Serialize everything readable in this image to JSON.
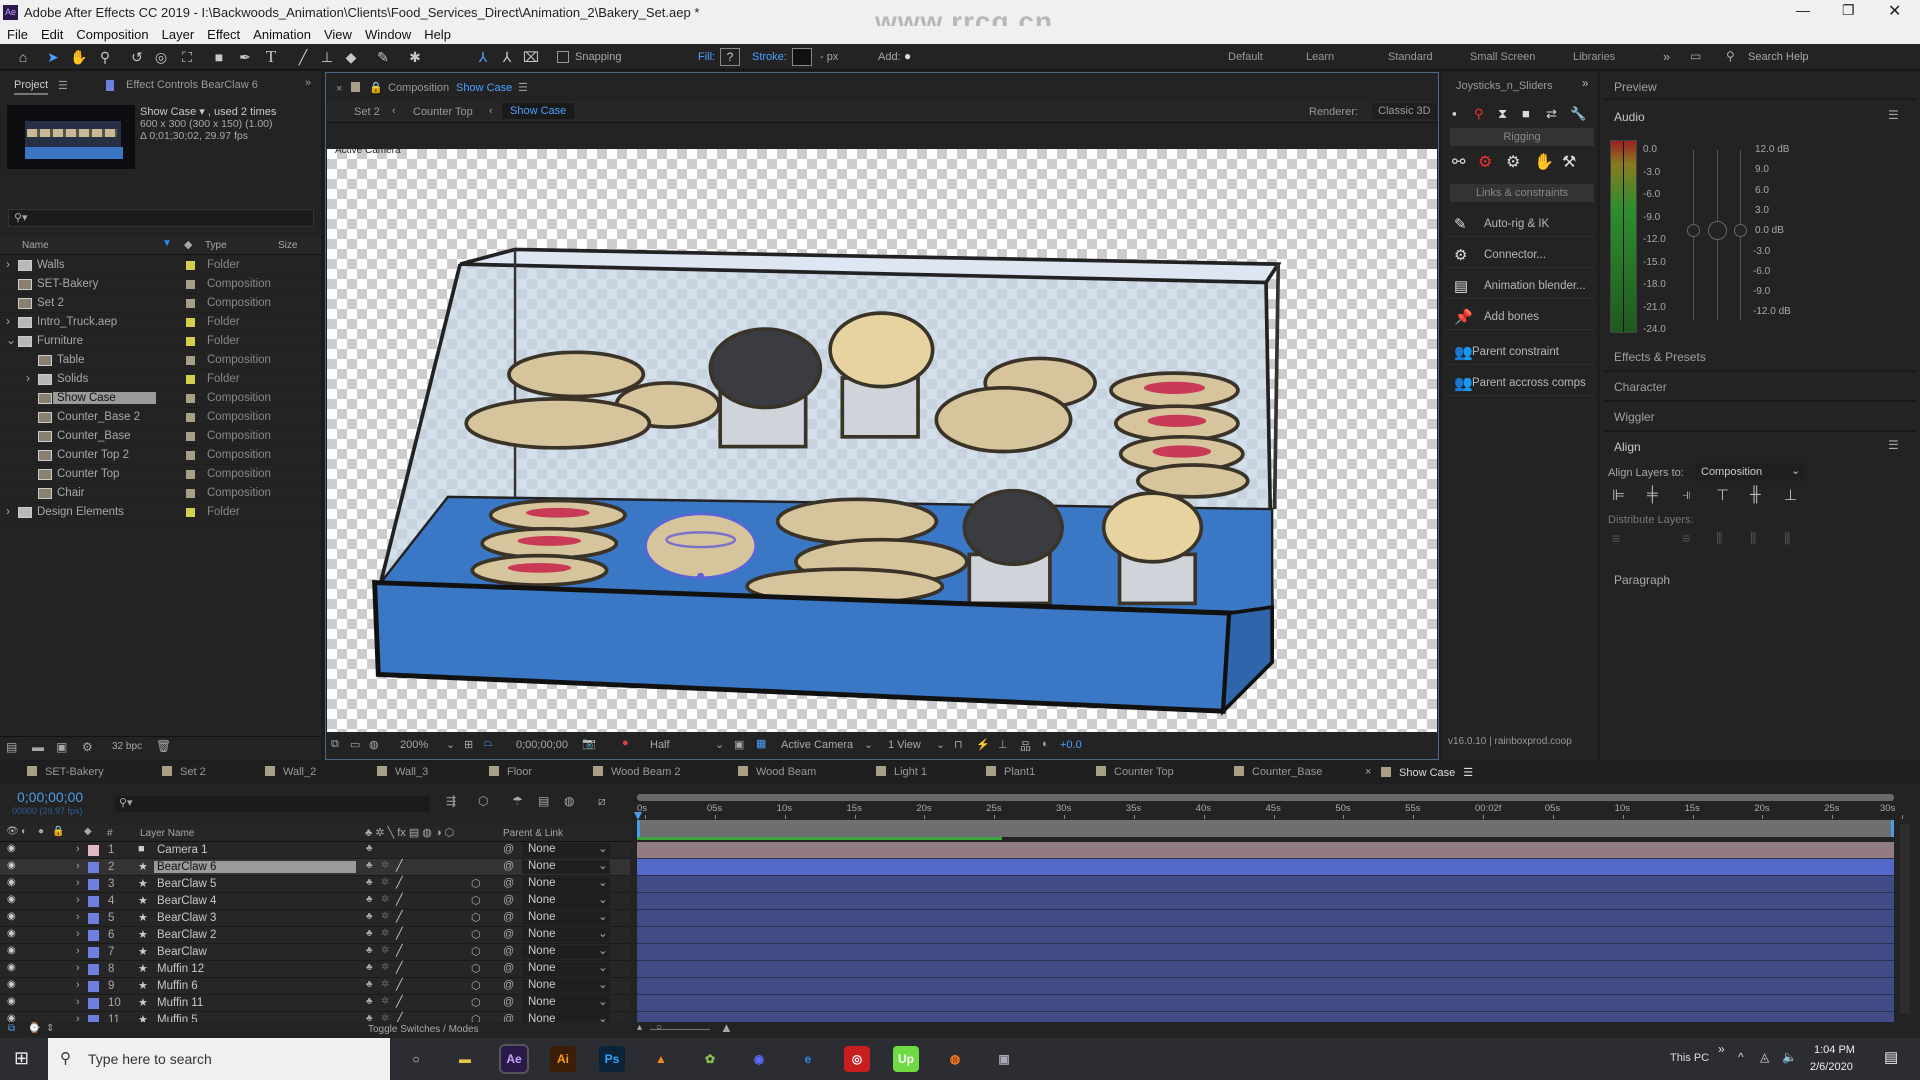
{
  "title_bar": {
    "app_icon": "Ae",
    "title": "Adobe After Effects CC 2019 - I:\\Backwoods_Animation\\Clients\\Food_Services_Direct\\Animation_2\\Bakery_Set.aep *",
    "watermark": "www.rrcg.cn",
    "controls": [
      "minimize-icon",
      "restore-icon",
      "close-icon"
    ]
  },
  "menu": [
    "File",
    "Edit",
    "Composition",
    "Layer",
    "Effect",
    "Animation",
    "View",
    "Window",
    "Help"
  ],
  "toolbar": {
    "snapping_label": "Snapping",
    "fill_label": "Fill:",
    "fill_value": "?",
    "stroke_label": "Stroke:",
    "stroke_units": "- px",
    "add_label": "Add:",
    "workspaces": [
      "Default",
      "Learn",
      "Standard",
      "Small Screen",
      "Libraries"
    ],
    "search_help": "Search Help"
  },
  "project_panel": {
    "tab_project": "Project",
    "tab_effect_controls": "Effect Controls BearClaw 6",
    "info_name": "Show Case ▾ , used 2 times",
    "info_size": "600 x 300  (300 x 150) (1.00)",
    "info_duration": "Δ 0;01;30;02, 29.97 fps",
    "search_placeholder": "",
    "columns": {
      "name": "Name",
      "type": "Type",
      "size": "Size"
    },
    "items": [
      {
        "name": "Walls",
        "type": "Folder",
        "kind": "folder",
        "depth": 0,
        "expander": "›"
      },
      {
        "name": "SET-Bakery",
        "type": "Composition",
        "kind": "comp",
        "depth": 0,
        "expander": ""
      },
      {
        "name": "Set 2",
        "type": "Composition",
        "kind": "comp",
        "depth": 0,
        "expander": ""
      },
      {
        "name": "Intro_Truck.aep",
        "type": "Folder",
        "kind": "folder",
        "depth": 0,
        "expander": "›"
      },
      {
        "name": "Furniture",
        "type": "Folder",
        "kind": "folder",
        "depth": 0,
        "expander": "⌄"
      },
      {
        "name": "Table",
        "type": "Composition",
        "kind": "comp",
        "depth": 1,
        "expander": ""
      },
      {
        "name": "Solids",
        "type": "Folder",
        "kind": "folder",
        "depth": 1,
        "expander": "›"
      },
      {
        "name": "Show Case",
        "type": "Composition",
        "kind": "comp",
        "depth": 1,
        "expander": "",
        "selected": true
      },
      {
        "name": "Counter_Base 2",
        "type": "Composition",
        "kind": "comp",
        "depth": 1,
        "expander": ""
      },
      {
        "name": "Counter_Base",
        "type": "Composition",
        "kind": "comp",
        "depth": 1,
        "expander": ""
      },
      {
        "name": "Counter Top 2",
        "type": "Composition",
        "kind": "comp",
        "depth": 1,
        "expander": ""
      },
      {
        "name": "Counter Top",
        "type": "Composition",
        "kind": "comp",
        "depth": 1,
        "expander": ""
      },
      {
        "name": "Chair",
        "type": "Composition",
        "kind": "comp",
        "depth": 1,
        "expander": ""
      },
      {
        "name": "Design Elements",
        "type": "Folder",
        "kind": "folder",
        "depth": 0,
        "expander": "›"
      }
    ],
    "bpc": "32 bpc"
  },
  "colors": {
    "folder_label": "#d4cf4c",
    "comp_label": "#a89f86",
    "accent": "#2d8ceb",
    "layer_blue": "#6f7fe0",
    "camera_pink": "#e0b8c2",
    "cache_green": "#3fa63f"
  },
  "composition_panel": {
    "tab_prefix": "Composition",
    "tab_name": "Show Case",
    "breadcrumbs": [
      "Set 2",
      "Counter Top",
      "Show Case"
    ],
    "renderer_label": "Renderer:",
    "renderer_value": "Classic 3D",
    "view_label": "Active Camera",
    "viewer_toolbar": {
      "zoom": "200%",
      "timecode": "0;00;00;00",
      "resolution": "Half",
      "camera": "Active Camera",
      "views": "1 View",
      "exposure": "+0.0"
    }
  },
  "joysticks_panel": {
    "title": "Joysticks_n_Sliders",
    "section_rigging": "Rigging",
    "section_links": "Links & constraints",
    "items": [
      "Auto-rig & IK",
      "Connector...",
      "Animation blender...",
      "Add bones",
      "Parent constraint",
      "Parent accross comps"
    ],
    "version": "v16.0.10 | rainboxprod.coop"
  },
  "right_panels": {
    "preview": "Preview",
    "audio": "Audio",
    "audio_left_scale": [
      "0.0",
      "-3.0",
      "-6.0",
      "-9.0",
      "-12.0",
      "-15.0",
      "-18.0",
      "-21.0",
      "-24.0"
    ],
    "audio_right_scale": [
      "12.0 dB",
      "9.0",
      "6.0",
      "3.0",
      "0.0 dB",
      "-3.0",
      "-6.0",
      "-9.0",
      "-12.0 dB"
    ],
    "effects_presets": "Effects & Presets",
    "character": "Character",
    "wiggler": "Wiggler",
    "align": "Align",
    "align_layers_to": "Align Layers to:",
    "align_target": "Composition",
    "distribute_layers": "Distribute Layers:",
    "paragraph": "Paragraph"
  },
  "timeline": {
    "tabs": [
      "SET-Bakery",
      "Set 2",
      "Wall_2",
      "Wall_3",
      "Floor",
      "Wood Beam 2",
      "Wood Beam",
      "Light 1",
      "Plant1",
      "Counter Top",
      "Counter_Base",
      "Show Case"
    ],
    "active_tab": "Show Case",
    "timecode": "0;00;00;00",
    "frame_info": "00000 (29.97 fps)",
    "columns": {
      "num": "#",
      "layer_name": "Layer Name",
      "parent": "Parent & Link"
    },
    "ruler": [
      "0s",
      "05s",
      "10s",
      "15s",
      "20s",
      "25s",
      "30s",
      "35s",
      "40s",
      "45s",
      "50s",
      "55s",
      "00:02f",
      "05s",
      "10s",
      "15s",
      "20s",
      "25s",
      "30s"
    ],
    "cache_fraction": 0.29,
    "layers": [
      {
        "num": "1",
        "name": "Camera 1",
        "icon": "camera",
        "color": "#e0b8c2",
        "three_d": false,
        "parent": "None"
      },
      {
        "num": "2",
        "name": "BearClaw 6",
        "icon": "star",
        "color": "#6f7fe0",
        "three_d": false,
        "parent": "None",
        "selected": true
      },
      {
        "num": "3",
        "name": "BearClaw 5",
        "icon": "star",
        "color": "#6f7fe0",
        "three_d": true,
        "parent": "None"
      },
      {
        "num": "4",
        "name": "BearClaw 4",
        "icon": "star",
        "color": "#6f7fe0",
        "three_d": true,
        "parent": "None"
      },
      {
        "num": "5",
        "name": "BearClaw 3",
        "icon": "star",
        "color": "#6f7fe0",
        "three_d": true,
        "parent": "None"
      },
      {
        "num": "6",
        "name": "BearClaw 2",
        "icon": "star",
        "color": "#6f7fe0",
        "three_d": true,
        "parent": "None"
      },
      {
        "num": "7",
        "name": "BearClaw",
        "icon": "star",
        "color": "#6f7fe0",
        "three_d": true,
        "parent": "None"
      },
      {
        "num": "8",
        "name": "Muffin 12",
        "icon": "star",
        "color": "#6f7fe0",
        "three_d": true,
        "parent": "None"
      },
      {
        "num": "9",
        "name": "Muffin 6",
        "icon": "star",
        "color": "#6f7fe0",
        "three_d": true,
        "parent": "None"
      },
      {
        "num": "10",
        "name": "Muffin 11",
        "icon": "star",
        "color": "#6f7fe0",
        "three_d": true,
        "parent": "None"
      },
      {
        "num": "11",
        "name": "Muffin 5",
        "icon": "star",
        "color": "#6f7fe0",
        "three_d": true,
        "parent": "None"
      }
    ],
    "toggle_label": "Toggle Switches / Modes"
  },
  "taskbar": {
    "search_placeholder": "Type here to search",
    "apps": [
      {
        "label": "",
        "name": "cortana-icon",
        "bg": "transparent",
        "fg": "#ddd"
      },
      {
        "label": "▬",
        "name": "file-explorer-icon",
        "bg": "transparent",
        "fg": "#e8c34a"
      },
      {
        "label": "Ae",
        "name": "after-effects-icon",
        "bg": "#2a1a4a",
        "fg": "#c9a0ff"
      },
      {
        "label": "Ai",
        "name": "illustrator-icon",
        "bg": "#3a1e05",
        "fg": "#ff9a1a"
      },
      {
        "label": "Ps",
        "name": "photoshop-icon",
        "bg": "#0a2438",
        "fg": "#31a8ff"
      },
      {
        "label": "▲",
        "name": "vlc-icon",
        "bg": "transparent",
        "fg": "#f08a1a"
      },
      {
        "label": "✿",
        "name": "app-icon",
        "bg": "transparent",
        "fg": "#8bc34a"
      },
      {
        "label": "◉",
        "name": "firefox-dev-icon",
        "bg": "transparent",
        "fg": "#5a6bff"
      },
      {
        "label": "e",
        "name": "edge-icon",
        "bg": "transparent",
        "fg": "#2d8ceb"
      },
      {
        "label": "◎",
        "name": "creative-cloud-icon",
        "bg": "#c81e1e",
        "fg": "#fff"
      },
      {
        "label": "Up",
        "name": "upwork-icon",
        "bg": "#6fda44",
        "fg": "#fff"
      },
      {
        "label": "◍",
        "name": "firefox-icon",
        "bg": "transparent",
        "fg": "#ff7a1a"
      },
      {
        "label": "▣",
        "name": "app-icon-2",
        "bg": "transparent",
        "fg": "#aab"
      }
    ],
    "tray_label": "This PC",
    "time": "1:04 PM",
    "date": "2/6/2020"
  }
}
